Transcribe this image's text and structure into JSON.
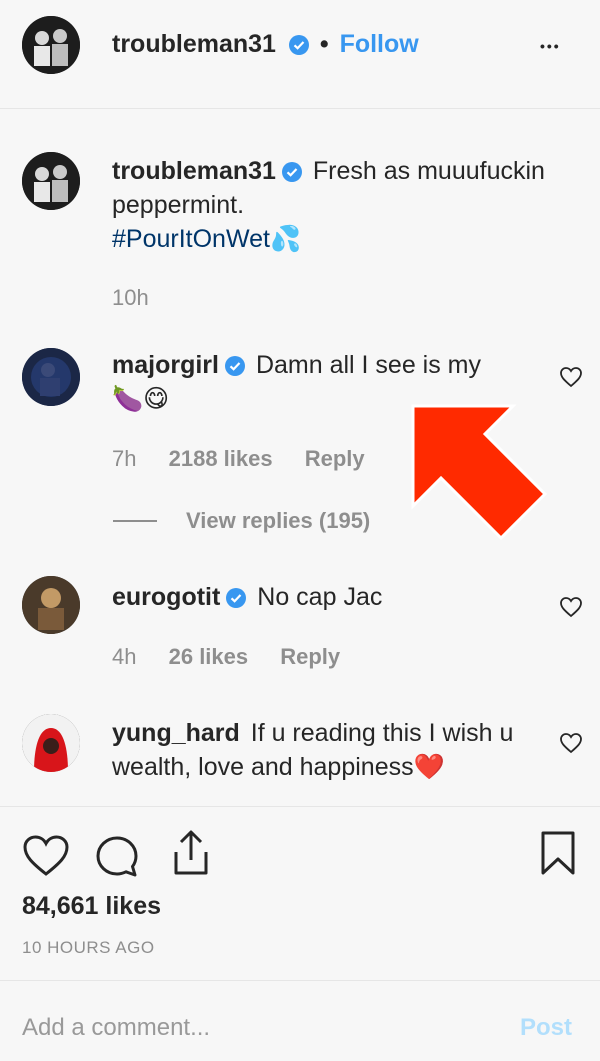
{
  "header": {
    "username": "troubleman31",
    "separator": "•",
    "follow_label": "Follow",
    "more_label": "•••"
  },
  "caption": {
    "username": "troubleman31",
    "text_line1": "Fresh as muuufuckin",
    "text_line2": "peppermint.",
    "hashtag": "#PourItOnWet",
    "emoji": "💦",
    "time": "10h"
  },
  "comments": [
    {
      "username": "majorgirl",
      "text": "Damn all I see is my",
      "emoji": "🍆😋",
      "time": "7h",
      "likes": "2188 likes",
      "reply": "Reply",
      "view_replies": "View replies (195)"
    },
    {
      "username": "eurogotit",
      "text": "No cap Jac",
      "time": "4h",
      "likes": "26 likes",
      "reply": "Reply"
    },
    {
      "username": "yung_hard",
      "text_line1": "If u reading this I wish u",
      "text_line2": "wealth, love and happiness",
      "emoji": "❤️"
    }
  ],
  "actions": {
    "likes_count": "84,661 likes",
    "timestamp": "10 HOURS AGO"
  },
  "comment_box": {
    "placeholder": "Add a comment...",
    "post_label": "Post"
  },
  "colors": {
    "accent": "#3897f0",
    "arrow": "#ff2a00",
    "text": "#262626",
    "muted": "#8e8e8e"
  }
}
